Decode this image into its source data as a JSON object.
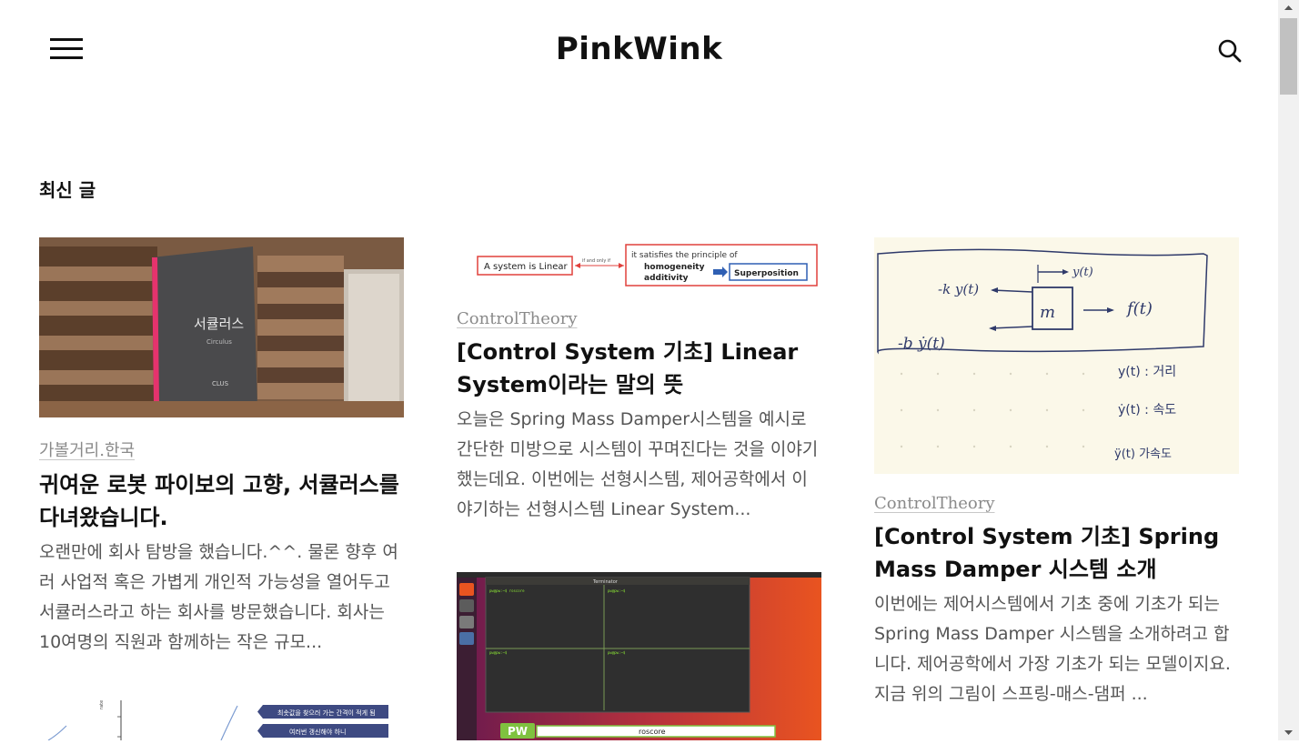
{
  "header": {
    "site_title": "PinkWink",
    "menu_icon": "hamburger-menu-icon",
    "search_icon": "search-icon"
  },
  "section": {
    "heading": "최신 글"
  },
  "posts": [
    {
      "category": "가볼거리.한국",
      "title": "귀여운 로봇 파이보의 고향, 서큘러스를 다녀왔습니다.",
      "excerpt": "오랜만에 회사 탐방을 했습니다.^^. 물론 향후 여러 사업적 혹은 가볍게 개인적 가능성을 열어두고 서큘러스라고 하는 회사를 방문했습니다. 회사는 10여명의 직원과 함께하는 작은 규모...",
      "thumb": {
        "sign_text": "서큘러스",
        "sign_sub": "Circulus",
        "sign_logo": "CLUS"
      }
    },
    {
      "category": "ControlTheory",
      "title": "[Control System 기초] Linear System이라는 말의 뜻",
      "excerpt": "오늘은 Spring Mass Damper시스템을 예시로 간단한 미방으로 시스템이 꾸며진다는 것을 이야기했는데요. 이번에는 선형시스템, 제어공학에서 이야기하는 선형시스템 Linear System...",
      "thumb": {
        "box1": "A system is Linear",
        "arrow_label": "if and only if",
        "box2_line1": "it satisfies the principle of",
        "box2_line2": "homogeneity",
        "box2_line3": "additivity",
        "box3": "Superposition"
      }
    },
    {
      "category": "ControlTheory",
      "title": "[Control System 기초] Spring Mass Damper 시스템 소개",
      "excerpt": "이번에는 제어시스템에서 기초 중에 기초가 되는 Spring Mass Damper 시스템을 소개하려고 합니다. 제어공학에서 가장 기초가 되는 모델이지요. 지금 위의 그림이 스프링-매스-댐퍼 ...",
      "thumb": {
        "spring_label": "-k y(t)",
        "damper_label": "-b ẏ(t)",
        "mass_label": "m",
        "force_label": "f(t)",
        "disp_label": "y(t)",
        "note1": "y(t) : 거리",
        "note2": "ẏ(t) : 속도",
        "note3": "ÿ(t) 가속도"
      }
    },
    {
      "thumb": {
        "label1": "최솟값을 찾으러 가는 간격이 적게 됨",
        "label2": "여러번 갱신해야 하니"
      }
    },
    {
      "thumb": {
        "window_title": "Terminator",
        "prompt": "pw@pw:~$ roscore",
        "badge": "PW",
        "bar_text": "roscore"
      }
    }
  ],
  "colors": {
    "accent_red": "#e0403c",
    "blue_box": "#2f5fb3",
    "ubuntu_orange": "#e95420",
    "ubuntu_purple": "#6b1a4e"
  }
}
